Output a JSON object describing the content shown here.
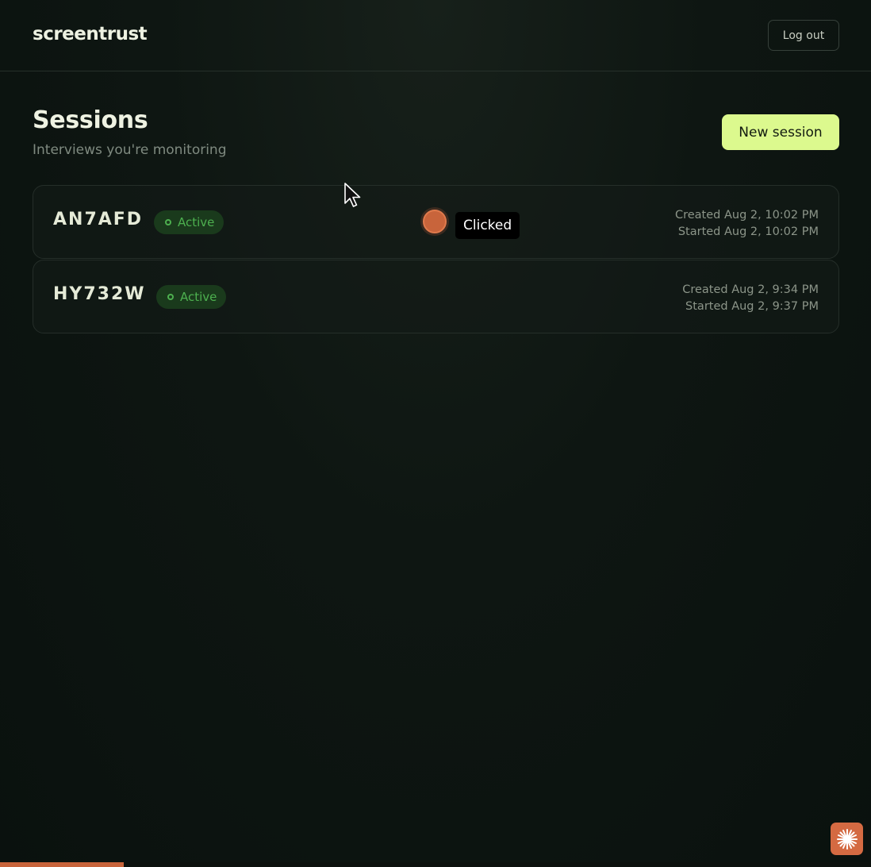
{
  "header": {
    "logo": "screentrust",
    "logout_label": "Log out"
  },
  "main": {
    "title": "Sessions",
    "subtitle": "Interviews you're monitoring",
    "new_session_label": "New session"
  },
  "sessions": [
    {
      "code": "AN7AFD",
      "status": "Active",
      "created": "Created Aug 2, 10:02 PM",
      "started": "Started Aug 2, 10:02 PM"
    },
    {
      "code": "HY732W",
      "status": "Active",
      "created": "Created Aug 2, 9:34 PM",
      "started": "Started Aug 2, 9:37 PM"
    }
  ],
  "overlay": {
    "click_label": "Clicked",
    "cursor_icon": "arrow-cursor-icon",
    "corner_icon": "sparkle-icon"
  },
  "progress": {
    "fraction": 0.142
  },
  "colors": {
    "accent": "#dcf98e",
    "status": "#4db04f",
    "marker": "#c8643b"
  }
}
